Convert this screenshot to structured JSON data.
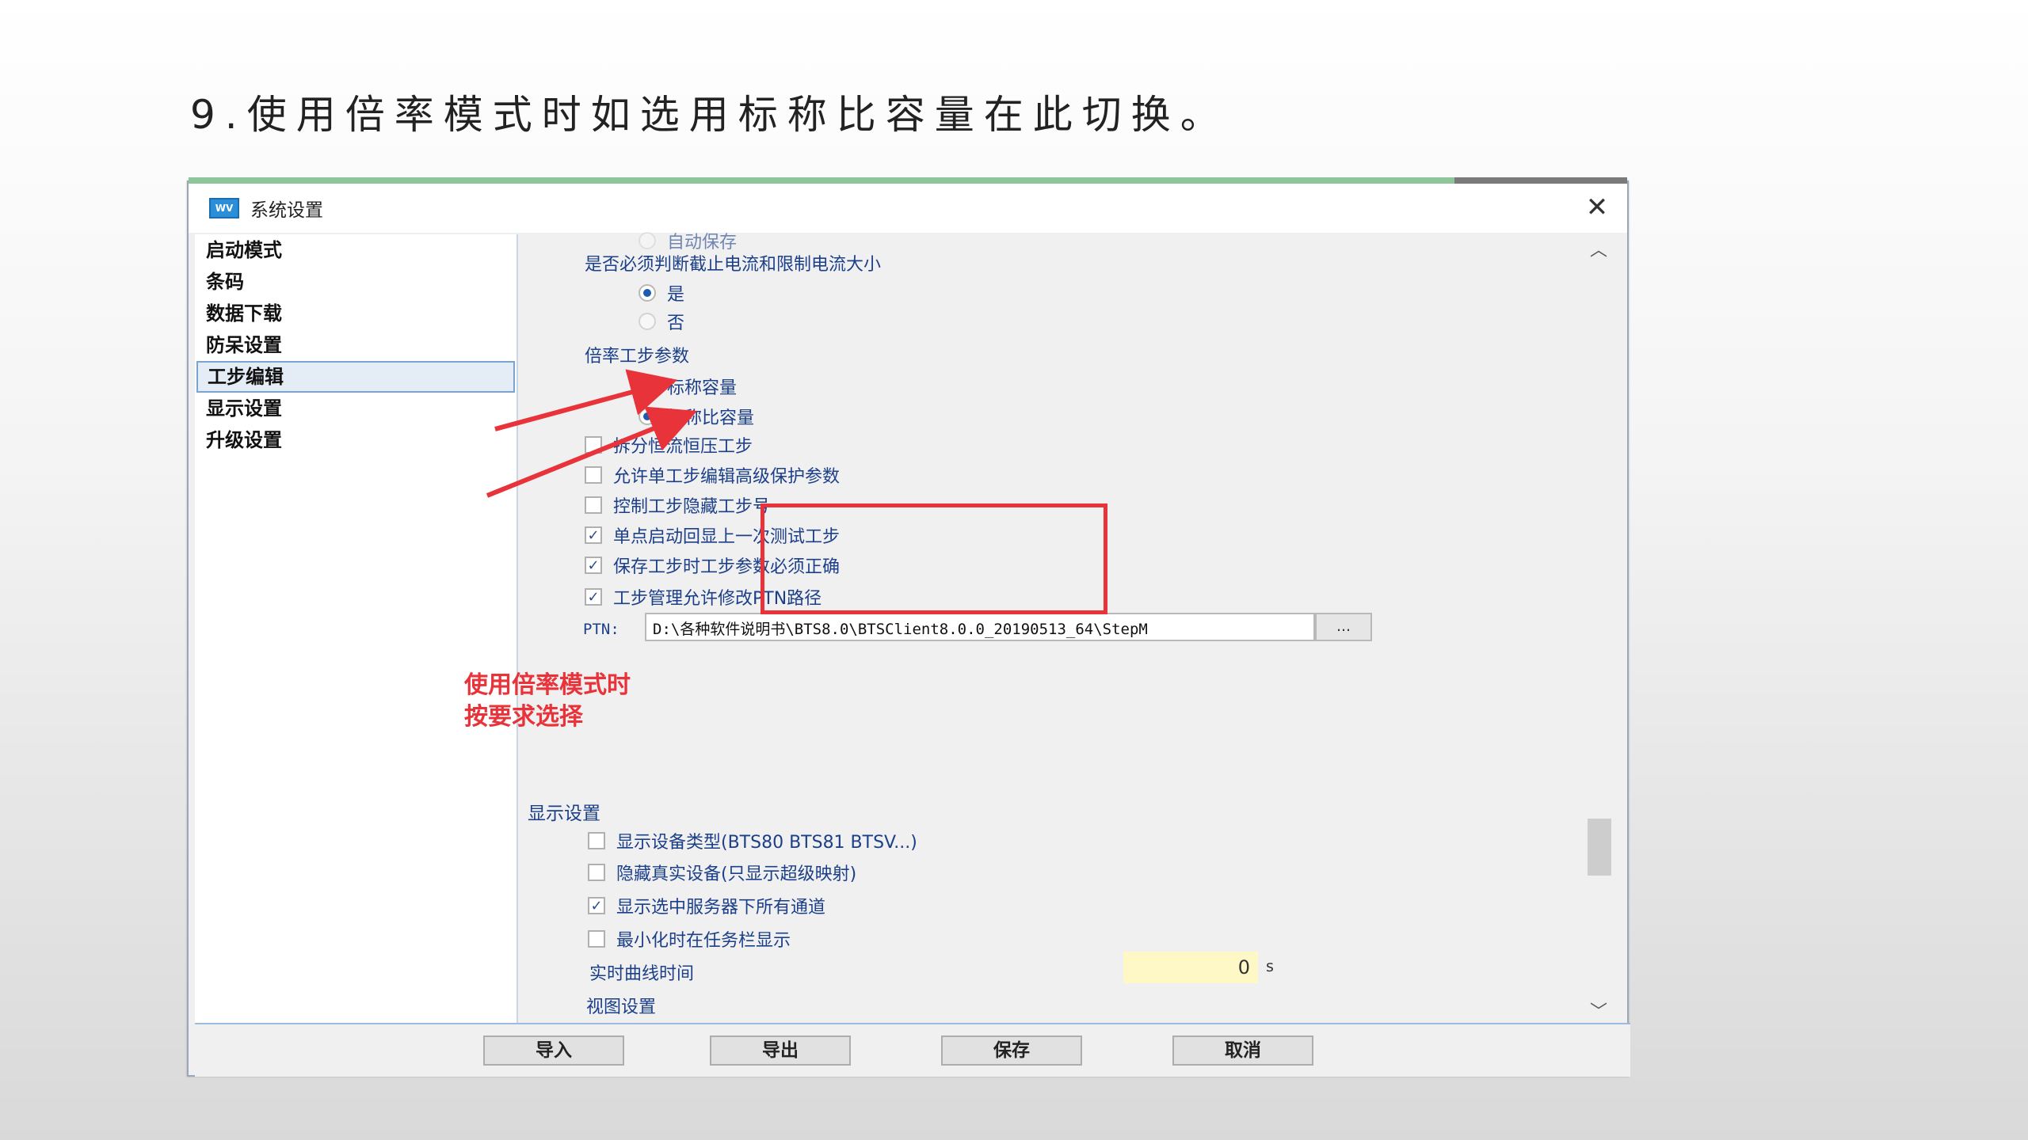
{
  "slide": {
    "title": "9.使用倍率模式时如选用标称比容量在此切换。"
  },
  "window": {
    "title": "系统设置",
    "close_glyph": "✕"
  },
  "sidebar": {
    "items": [
      {
        "label": "启动模式"
      },
      {
        "label": "条码"
      },
      {
        "label": "数据下载"
      },
      {
        "label": "防呆设置"
      },
      {
        "label": "工步编辑",
        "active": true
      },
      {
        "label": "显示设置"
      },
      {
        "label": "升级设置"
      }
    ]
  },
  "content": {
    "partial_top_option": "自动保存",
    "cutoff_question": "是否必须判断截止电流和限制电流大小",
    "cutoff_options": {
      "yes": "是",
      "no": "否",
      "selected": "yes"
    },
    "rate_step_params": {
      "label": "倍率工步参数",
      "options": [
        "标称容量",
        "标称比容量"
      ],
      "selected": "标称比容量"
    },
    "checkboxes": [
      {
        "label": "拆分恒流恒压工步",
        "checked": false
      },
      {
        "label": "允许单工步编辑高级保护参数",
        "checked": false
      },
      {
        "label": "控制工步隐藏工步号",
        "checked": false
      },
      {
        "label": "单点启动回显上一次测试工步",
        "checked": true
      },
      {
        "label": "保存工步时工步参数必须正确",
        "checked": true
      },
      {
        "label": "工步管理允许修改PTN路径",
        "checked": true
      }
    ],
    "ptn": {
      "label": "PTN:",
      "value": "D:\\各种软件说明书\\BTS8.0\\BTSClient8.0.0_20190513_64\\StepM",
      "browse_label": "..."
    },
    "display_section": {
      "title": "显示设置",
      "checkboxes": [
        {
          "label": "显示设备类型(BTS80 BTS81 BTSV...)",
          "checked": false
        },
        {
          "label": "隐藏真实设备(只显示超级映射)",
          "checked": false
        },
        {
          "label": "显示选中服务器下所有通道",
          "checked": true
        },
        {
          "label": "最小化时在任务栏显示",
          "checked": false
        }
      ],
      "realtime_curve_label": "实时曲线时间",
      "realtime_curve_value": "0",
      "realtime_curve_unit": "s",
      "view_settings_label": "视图设置"
    }
  },
  "footer": {
    "buttons": {
      "import": "导入",
      "export": "导出",
      "save": "保存",
      "cancel": "取消"
    }
  },
  "annotation": {
    "line1": "使用倍率模式时",
    "line2": "按要求选择"
  },
  "colors": {
    "annotation_red": "#e8333a",
    "label_blue": "#1c3f8a",
    "input_yellow": "#fdf8c6"
  }
}
